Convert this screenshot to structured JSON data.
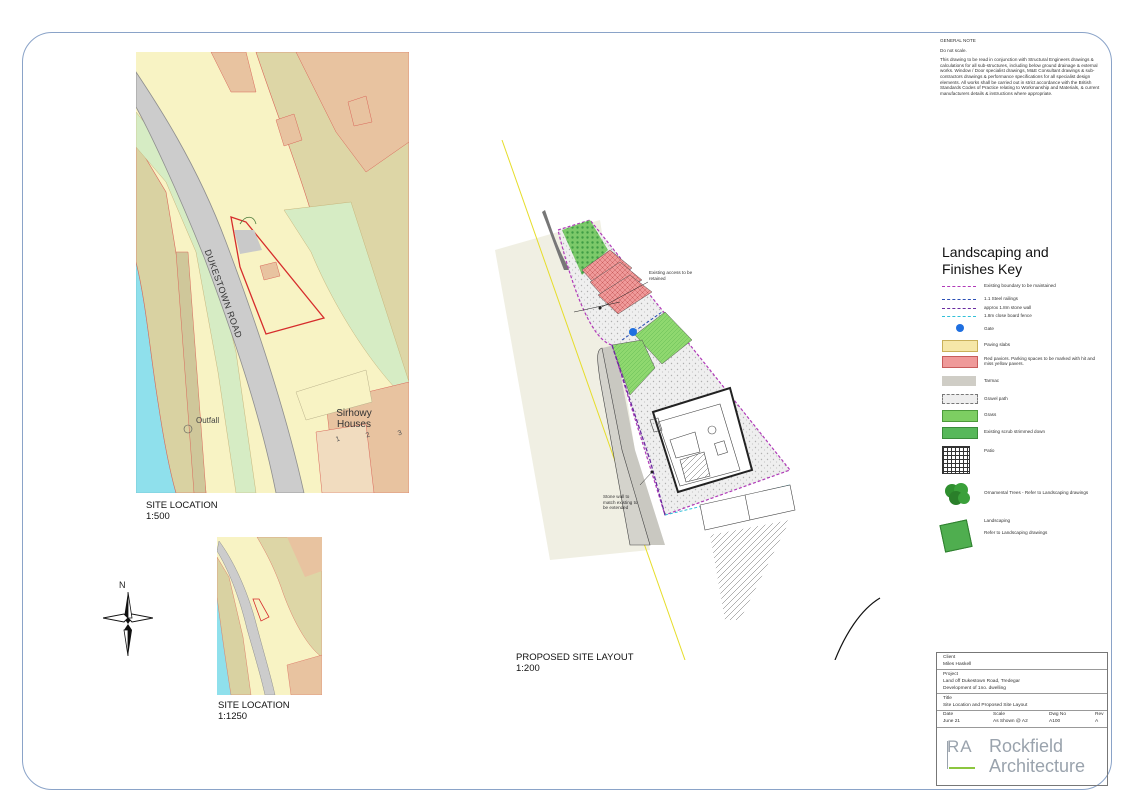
{
  "general_note": {
    "heading": "GENERAL NOTE",
    "line1": "Do not scale.",
    "body": "This drawing to be read in conjunction with Structural Engineers drawings & calculations for all sub-structures, including below ground drainage & external works. Window / Door specialist drawings, M&E Consultant drawings & sub-contractors drawings & performance specifications for all specialist design elements. All works shall be carried out in strict accordance with the British Standards Codes of Practice relating to Workmanship and Materials, & current manufacturers details & instructions where appropriate."
  },
  "map1": {
    "road_label": "DUKESTOWN ROAD",
    "outfall_label": "Outfall",
    "houses_label": "Sirhowy Houses",
    "house_numbers": [
      "1",
      "2",
      "3"
    ],
    "caption": "SITE LOCATION",
    "scale": "1:500"
  },
  "map2": {
    "caption": "SITE LOCATION",
    "scale": "1:1250"
  },
  "north_label": "N",
  "layout": {
    "caption": "PROPOSED SITE LAYOUT",
    "scale": "1:200",
    "note_access": "Existing access to be retained",
    "note_wall": "Stone wall to match existing to be extended"
  },
  "key": {
    "title_line1": "Landscaping and",
    "title_line2": "Finishes Key",
    "items": [
      {
        "label": "Existing boundary to be maintained",
        "color": "#b03ab8"
      },
      {
        "label": "1.1 Steel railings",
        "color": "#2a4fb5"
      },
      {
        "label": "approx 1.8m stone wall",
        "color": "#6a2ca0"
      },
      {
        "label": "1.8m close board fence",
        "color": "#32c0d8"
      },
      {
        "label": "Gate",
        "color": "#1f6fe0"
      },
      {
        "label": "Paving slabs",
        "color": "#f6e7a8"
      },
      {
        "label": "Red paviors. Parking spaces to be marked with hit and miss yellow pavers.",
        "color": "#e98f8f"
      },
      {
        "label": "Tarmac",
        "color": "#cfcdc6"
      },
      {
        "label": "Gravel path",
        "color": "#eeeeee"
      },
      {
        "label": "Grass",
        "color": "#7dce62"
      },
      {
        "label": "Existing scrub strimmed down",
        "color": "#57b85a"
      },
      {
        "label": "Patio",
        "color": "#ffffff"
      },
      {
        "label": "Ornamental Trees - Refer to Landscaping drawings",
        "color": "#2f8f2f"
      },
      {
        "label": "Landscaping",
        "color": "#4fae4f"
      },
      {
        "label": "Refer to Landscaping drawings",
        "color": "#4fae4f"
      }
    ]
  },
  "title_block": {
    "client_label": "Client",
    "client": "Miles Haskell",
    "project_label": "Project",
    "project_line1": "Land off Dukestown Road, Tredegar",
    "project_line2": "Development of 1no. dwelling",
    "title_label": "Title",
    "title": "Site Location and Proposed Site Layout",
    "date_label": "Date",
    "date": "June 21",
    "scale_label": "Scale",
    "scale": "As Shown @ A2",
    "dwg_label": "Dwg No",
    "dwg": "A100",
    "rev_label": "Rev",
    "rev": "A",
    "logo_initials": "RA",
    "logo_line1": "Rockfield",
    "logo_line2": "Architecture"
  }
}
